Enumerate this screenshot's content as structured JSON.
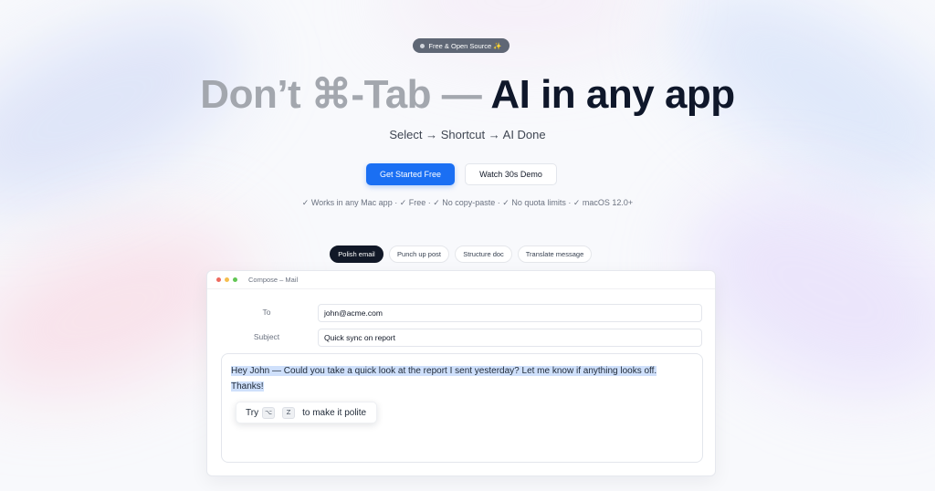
{
  "badge": {
    "label": "Free & Open Source ✨"
  },
  "headline": {
    "muted": "Don’t ⌘-Tab — ",
    "strong": "AI in any app"
  },
  "subheadline": "Select → Shortcut → AI Done",
  "cta": {
    "primary": "Get Started Free",
    "secondary": "Watch 30s Demo"
  },
  "features": "✓ Works in any Mac app · ✓ Free · ✓ No copy-paste · ✓ No quota limits · ✓ macOS 12.0+",
  "chips": [
    {
      "label": "Polish email",
      "active": true
    },
    {
      "label": "Punch up post",
      "active": false
    },
    {
      "label": "Structure doc",
      "active": false
    },
    {
      "label": "Translate message",
      "active": false
    }
  ],
  "window": {
    "title": "Compose – Mail",
    "to_label": "To",
    "to_value": "john@acme.com",
    "subject_label": "Subject",
    "subject_value": "Quick sync on report",
    "body_line1": "Hey John — Could you take a quick look at the report I sent yesterday? Let me know if anything looks off.",
    "body_line2": "Thanks!",
    "tip": {
      "prefix": "Try",
      "key1": "⌥",
      "key2": "Z",
      "suffix": "to make it polite"
    }
  },
  "colors": {
    "accent": "#1a6ff3",
    "dark": "#0f172a",
    "muted_heading": "#a3a7ae",
    "selection": "#cfe0fb"
  }
}
